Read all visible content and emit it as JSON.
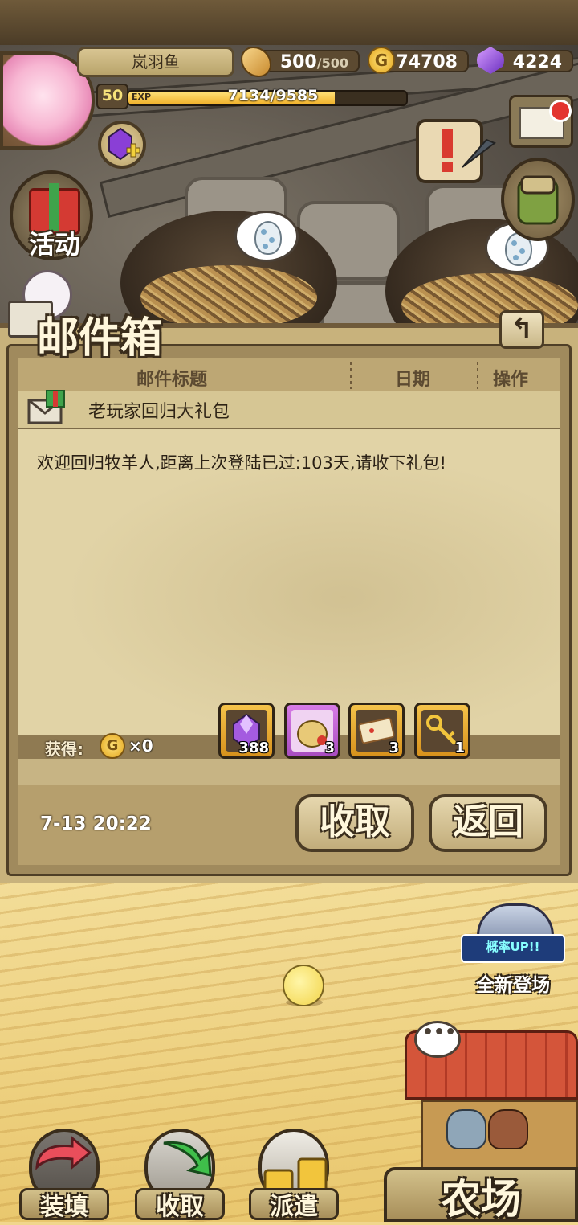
{
  "player": {
    "name": "岚羽鱼",
    "level": "50",
    "exp_tag": "EXP",
    "exp_text": "7134/9585",
    "exp_progress": 0.744
  },
  "resources": {
    "stamina_value": "500",
    "stamina_max": "/500",
    "gold": "74708",
    "gems": "4224",
    "coin_symbol": "G"
  },
  "side_buttons": {
    "activity_label": "活动"
  },
  "mailbox": {
    "title": "邮件箱",
    "back_arrow": "↰",
    "headers": [
      "邮件标题",
      "日期",
      "操作"
    ],
    "subject": "老玩家回归大礼包",
    "body": "欢迎回归牧羊人,距离上次登陆已过:103天,请收下礼包!",
    "got_label": "获得:",
    "gold_count": "×0",
    "items": [
      {
        "icon": "purple-gem-icon",
        "count": "388",
        "frame": "orange"
      },
      {
        "icon": "gold-sack-icon",
        "count": "3",
        "frame": "purple"
      },
      {
        "icon": "ticket-icon",
        "count": "3",
        "frame": "orange"
      },
      {
        "icon": "golden-key-icon",
        "count": "1",
        "frame": "orange"
      }
    ],
    "date": "7-13 20:22",
    "collect_label": "收取",
    "return_label": "返回"
  },
  "event": {
    "badge": "概率UP!!",
    "label": "全新登场"
  },
  "bottom_nav": {
    "load_label": "装填",
    "collect_label": "收取",
    "dispatch_label": "派遣",
    "farm_label": "农场"
  }
}
